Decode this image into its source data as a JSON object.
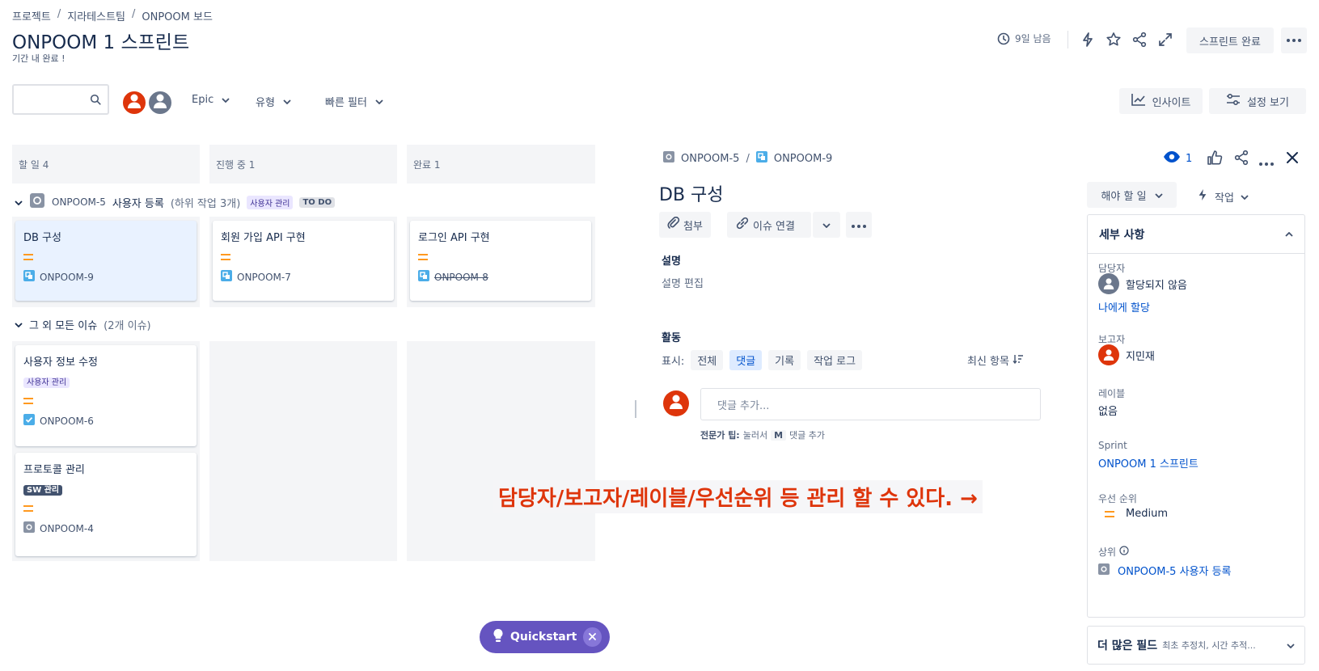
{
  "breadcrumb": {
    "items": [
      "프로젝트",
      "지라테스트팀",
      "ONPOOM 보드"
    ],
    "separator": "/"
  },
  "header": {
    "title": "ONPOOM 1 스프린트",
    "subtitle": "기간 내 완료 !",
    "time_left": "9일 남음",
    "complete_sprint": "스프린트 완료"
  },
  "toolbar": {
    "filters": [
      {
        "label": "Epic"
      },
      {
        "label": "유형"
      },
      {
        "label": "빠른 필터"
      }
    ],
    "insights": "인사이트",
    "view_settings": "설정 보기"
  },
  "board": {
    "columns": [
      {
        "label": "할 일 4"
      },
      {
        "label": "진행 중 1"
      },
      {
        "label": "완료 1"
      }
    ],
    "group1": {
      "key": "ONPOOM-5",
      "title": "사용자 등록",
      "subtasks": "(하위 작업 3개)",
      "label": "사용자 관리",
      "status": "TO DO",
      "cards": [
        {
          "title": "DB 구성",
          "key": "ONPOOM-9"
        },
        {
          "title": "회원 가입 API 구현",
          "key": "ONPOOM-7"
        },
        {
          "title": "로그인 API 구현",
          "key": "ONPOOM-8"
        }
      ]
    },
    "group2": {
      "title": "그 외 모든 이슈",
      "count": "(2개 이슈)",
      "cards": [
        {
          "title": "사용자 정보 수정",
          "label": "사용자 관리",
          "key": "ONPOOM-6"
        },
        {
          "title": "프로토콜 관리",
          "label": "SW 관리",
          "key": "ONPOOM-4"
        }
      ]
    }
  },
  "detail": {
    "parent_key": "ONPOOM-5",
    "key": "ONPOOM-9",
    "watchers": "1",
    "title": "DB 구성",
    "attach": "첨부",
    "link_issue": "이슈 연결",
    "description_label": "설명",
    "description_placeholder": "설명 편집",
    "activity_label": "활동",
    "show_label": "표시:",
    "activity_tabs": [
      {
        "label": "전체"
      },
      {
        "label": "댓글"
      },
      {
        "label": "기록"
      },
      {
        "label": "작업 로그"
      }
    ],
    "sort_label": "최신 항목",
    "comment_placeholder": "댓글 추가...",
    "tip_bold": "전문가 팁:",
    "tip_press": "눌러서",
    "tip_key": "M",
    "tip_action": "댓글 추가"
  },
  "annotation": "담당자/보고자/레이블/우선순위 등 관리 할 수 있다. →",
  "sidebar": {
    "status_button": "해야 할 일",
    "actions_button": "작업",
    "details_title": "세부 사항",
    "assignee_label": "담당자",
    "assignee_value": "할당되지 않음",
    "assign_to_me": "나에게 할당",
    "reporter_label": "보고자",
    "reporter_value": "지민재",
    "labels_label": "레이블",
    "labels_value": "없음",
    "sprint_label": "Sprint",
    "sprint_value": "ONPOOM 1 스프린트",
    "priority_label": "우선 순위",
    "priority_value": "Medium",
    "parent_label": "상위",
    "parent_value": "ONPOOM-5 사용자 등록",
    "more_fields": "더 많은 필드",
    "more_fields_hint": "최초 추정치, 시간 추적..."
  },
  "quickstart": {
    "label": "Quickstart"
  },
  "colors": {
    "accent": "#0052cc",
    "annotation": "#de350b",
    "priority_medium": "#ff991f",
    "quickstart": "#6554c0",
    "label_purple_bg": "#eae6ff",
    "label_purple_fg": "#403294",
    "label_dark_bg": "#42526e"
  }
}
